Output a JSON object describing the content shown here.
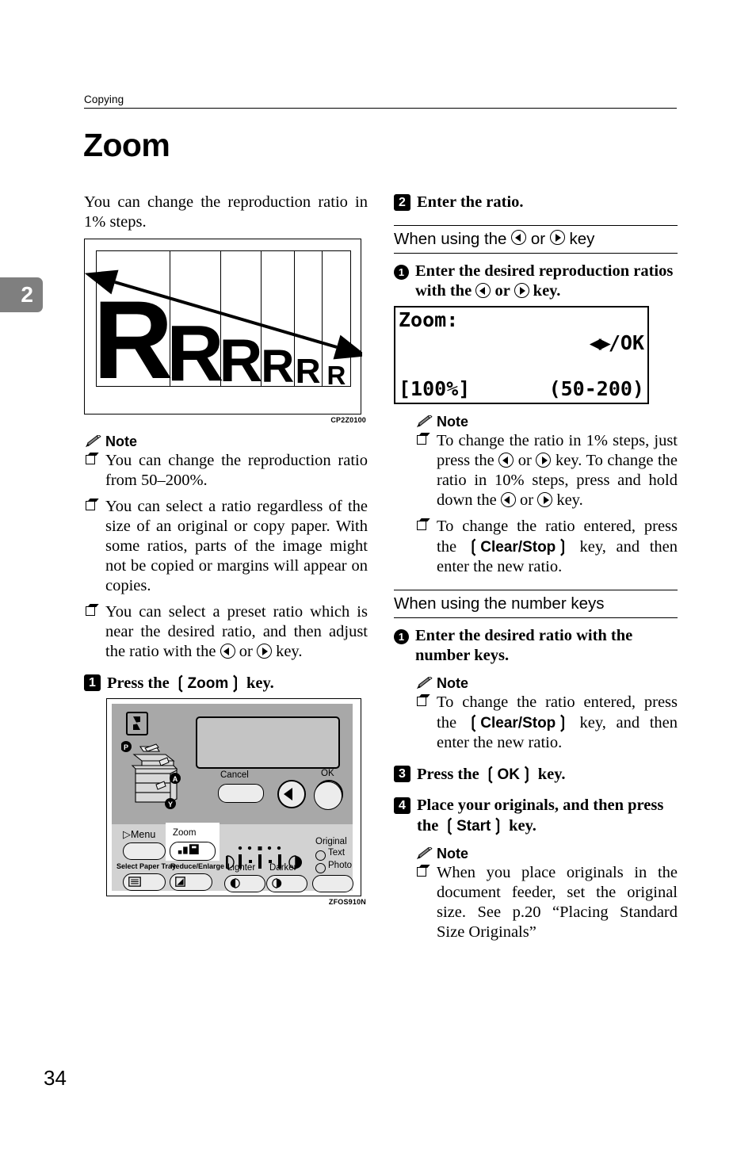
{
  "header": {
    "running_head": "Copying",
    "chapter_tab": "2",
    "page_number": "34"
  },
  "title": "Zoom",
  "left_column": {
    "intro": "You can change the reproduction ratio in 1% steps.",
    "figure_zoom": {
      "caption": "CP2Z0100",
      "letters": [
        "R",
        "R",
        "R",
        "R",
        "R",
        "R"
      ]
    },
    "note_heading": "Note",
    "notes": [
      "You can change the reproduction ratio from 50–200%.",
      "You can select a ratio regardless of the size of an original or copy paper. With some ratios, parts of the image might not be copied or margins will appear on copies.",
      "You can select a preset ratio which is near the desired ratio, and then adjust the ratio with the {LEFT} or {RIGHT} key."
    ],
    "step1": {
      "marker": "1",
      "text_before": "Press the",
      "key": "Zoom",
      "text_after": "key."
    },
    "figure_panel": {
      "caption": "ZFOS910N",
      "screen_label": "",
      "labels": {
        "cancel": "Cancel",
        "ok": "OK",
        "menu": "Menu",
        "zoom": "Zoom",
        "select_paper_tray": "Select Paper Tray",
        "reduce_enlarge": "Reduce/Enlarge",
        "lighter": "Lighter",
        "darker": "Darker",
        "original": "Original",
        "text": "Text",
        "photo": "Photo",
        "indicator_p": "P",
        "indicator_a": "A",
        "indicator_y": "Y"
      }
    }
  },
  "right_column": {
    "step2": {
      "marker": "2",
      "text": "Enter the ratio."
    },
    "section_arrow_keys": {
      "heading_before": "When using the",
      "heading_or": "or",
      "heading_after": "key",
      "substep": {
        "marker": "1",
        "text": "Enter the desired reproduction ratios with the {LEFT} or {RIGHT} key."
      },
      "lcd": {
        "row1_left": "Zoom:",
        "row1_right": "/OK",
        "row2_left": "[100%]",
        "row2_right": "(50-200)"
      },
      "note_heading": "Note",
      "notes": [
        "To change the ratio in 1% steps, just press the {LEFT} or {RIGHT} key. To change the ratio in 10% steps, press and hold down the {LEFT} or {RIGHT} key.",
        "To change the ratio entered, press the {KEY:Clear/Stop} key, and then enter the new ratio."
      ]
    },
    "section_number_keys": {
      "heading": "When using the number keys",
      "substep": {
        "marker": "1",
        "text": "Enter the desired ratio with the number keys."
      },
      "note_heading": "Note",
      "notes": [
        "To change the ratio entered, press the {KEY:Clear/Stop} key, and then enter the new ratio."
      ]
    },
    "step3": {
      "marker": "3",
      "text_before": "Press the",
      "key": "OK",
      "text_after": "key."
    },
    "step4": {
      "marker": "4",
      "text_before": "Place your originals, and then press the",
      "key": "Start",
      "text_after": "key."
    },
    "step4_note_heading": "Note",
    "step4_notes": [
      "When you place originals in the document feeder, set the original size. See p.20 “Placing Standard Size Originals”"
    ]
  },
  "colors": {
    "chapter_tab_bg": "#7f7f7f",
    "panel_upper": "#a8a8a8",
    "panel_lower": "#d2d2d2",
    "screen": "#c4c4c4",
    "button": "#ececec"
  }
}
